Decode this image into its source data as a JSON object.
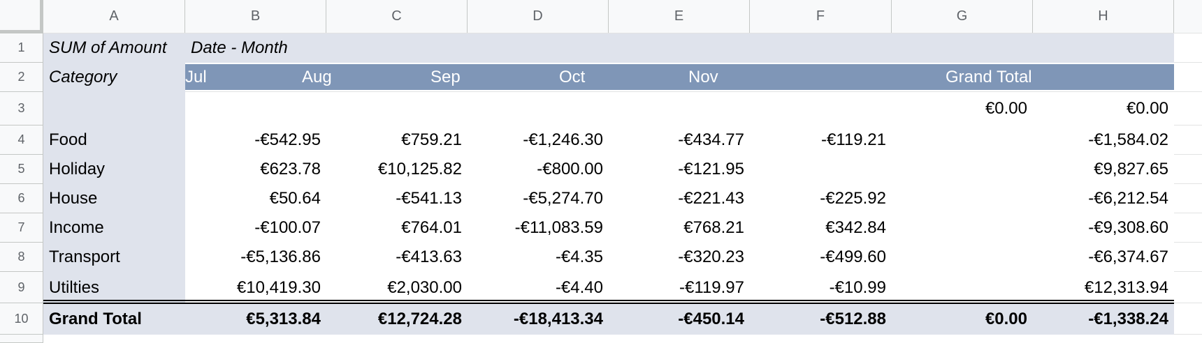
{
  "sheet": {
    "columns": [
      "A",
      "B",
      "C",
      "D",
      "E",
      "F",
      "G",
      "H"
    ],
    "rows": [
      "1",
      "2",
      "3",
      "4",
      "5",
      "6",
      "7",
      "8",
      "9",
      "10"
    ],
    "colors": {
      "header_light": "#dfe3ec",
      "header_dark": "#7f96b7",
      "total_row": "#dfe3ec"
    }
  },
  "pivot": {
    "value_label": "SUM of Amount",
    "column_field": "Date - Month",
    "row_field": "Category",
    "months": [
      "Jul",
      "Aug",
      "Sep",
      "Oct",
      "Nov",
      "",
      "Grand Total"
    ],
    "rows": [
      {
        "label": "",
        "values": [
          "",
          "",
          "",
          "",
          "",
          "€0.00",
          "€0.00"
        ]
      },
      {
        "label": "Food",
        "values": [
          "-€542.95",
          "€759.21",
          "-€1,246.30",
          "-€434.77",
          "-€119.21",
          "",
          "-€1,584.02"
        ]
      },
      {
        "label": "Holiday",
        "values": [
          "€623.78",
          "€10,125.82",
          "-€800.00",
          "-€121.95",
          "",
          "",
          "€9,827.65"
        ]
      },
      {
        "label": "House",
        "values": [
          "€50.64",
          "-€541.13",
          "-€5,274.70",
          "-€221.43",
          "-€225.92",
          "",
          "-€6,212.54"
        ]
      },
      {
        "label": "Income",
        "values": [
          "-€100.07",
          "€764.01",
          "-€11,083.59",
          "€768.21",
          "€342.84",
          "",
          "-€9,308.60"
        ]
      },
      {
        "label": "Transport",
        "values": [
          "-€5,136.86",
          "-€413.63",
          "-€4.35",
          "-€320.23",
          "-€499.60",
          "",
          "-€6,374.67"
        ]
      },
      {
        "label": "Utilties",
        "values": [
          "€10,419.30",
          "€2,030.00",
          "-€4.40",
          "-€119.97",
          "-€10.99",
          "",
          "€12,313.94"
        ]
      }
    ],
    "grand_total": {
      "label": "Grand Total",
      "values": [
        "€5,313.84",
        "€12,724.28",
        "-€18,413.34",
        "-€450.14",
        "-€512.88",
        "€0.00",
        "-€1,338.24"
      ]
    }
  }
}
